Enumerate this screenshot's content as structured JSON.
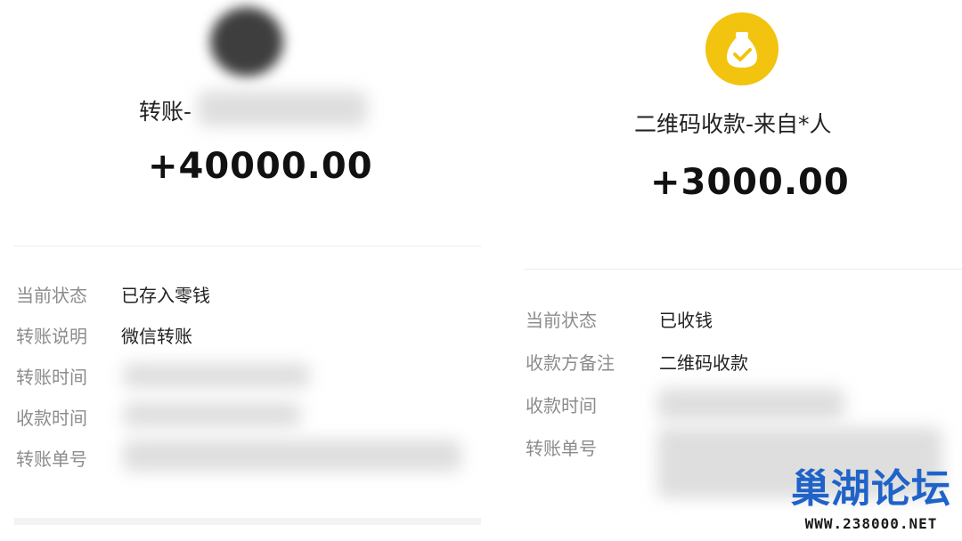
{
  "left": {
    "title": "转账-",
    "amount": "+40000.00",
    "rows": [
      {
        "label": "当前状态",
        "value": "已存入零钱"
      },
      {
        "label": "转账说明",
        "value": "微信转账"
      },
      {
        "label": "转账时间",
        "value": ""
      },
      {
        "label": "收款时间",
        "value": ""
      },
      {
        "label": "转账单号",
        "value": ""
      }
    ]
  },
  "right": {
    "icon": "money-bag-check-icon",
    "title": "二维码收款-来自*人",
    "amount": "+3000.00",
    "rows": [
      {
        "label": "当前状态",
        "value": "已收钱"
      },
      {
        "label": "收款方备注",
        "value": "二维码收款"
      },
      {
        "label": "收款时间",
        "value": ""
      },
      {
        "label": "转账单号",
        "value": ""
      }
    ]
  },
  "watermark": {
    "title": "巢湖论坛",
    "url": "WWW.238000.NET"
  },
  "colors": {
    "icon_bg": "#f2c40f",
    "watermark_blue": "#1f63c9",
    "label_gray": "#8c8c8c"
  }
}
